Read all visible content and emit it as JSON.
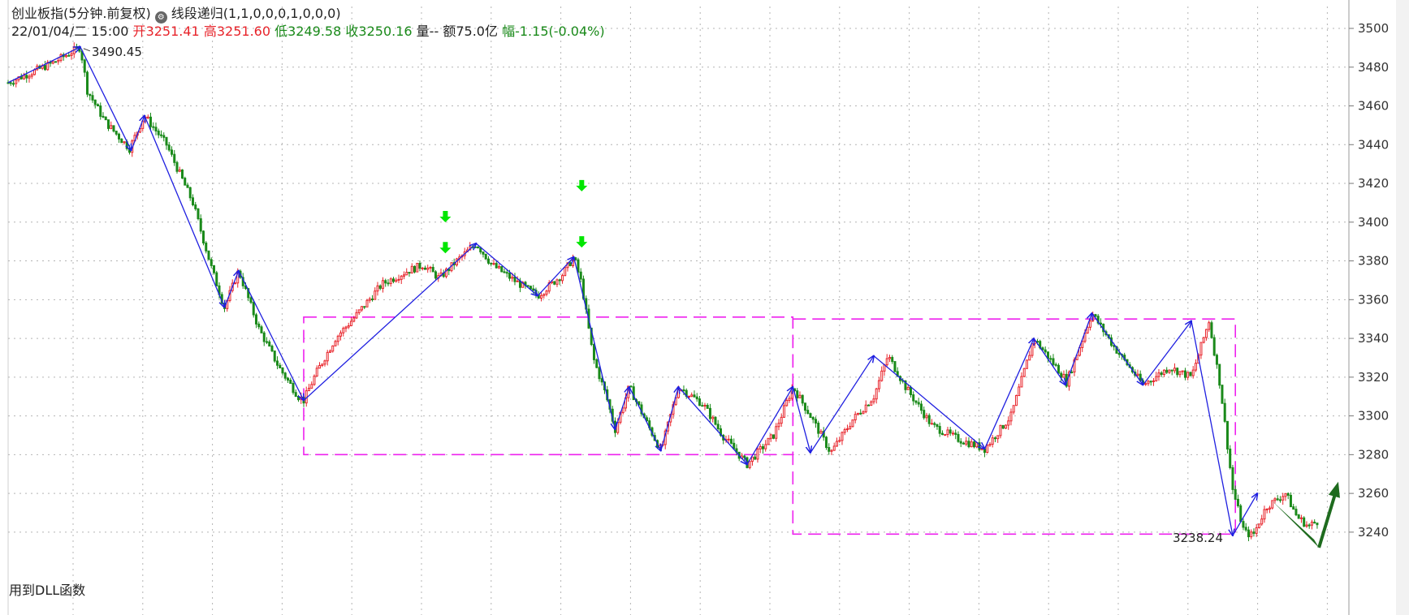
{
  "header": {
    "title": "创业板指(5分钟.前复权)",
    "indicator": "线段递归(1,1,0,0,0,1,0,0,0)",
    "datetime": "22/01/04/二 15:00",
    "open_label": "开",
    "open_value": "3251.41",
    "high_label": "高",
    "high_value": "3251.60",
    "low_label": "低",
    "low_value": "3249.58",
    "close_label": "收",
    "close_value": "3250.16",
    "volume_label": "量--",
    "amount_label": "额",
    "amount_value": "75.0亿",
    "change_label": "幅",
    "change_value": "-1.15(-0.04%)"
  },
  "footer_note": "用到DLL函数",
  "colors": {
    "up": "#e8242b",
    "down": "#1a8a1a",
    "zigzag": "#1f1fe0",
    "box": "#ee22ee",
    "signal": "#00e600",
    "big_arrow": "#1e6b1e",
    "grid": "#b4b4b4"
  },
  "chart_data": {
    "type": "candlestick",
    "ylim": [
      3226,
      3508
    ],
    "xlim": [
      0,
      1000
    ],
    "y_ticks": [
      3240,
      3260,
      3280,
      3300,
      3320,
      3340,
      3360,
      3380,
      3400,
      3420,
      3440,
      3460,
      3480,
      3500
    ],
    "grid": true,
    "price_path": [
      [
        0,
        3472
      ],
      [
        50,
        3482
      ],
      [
        82,
        3490.45
      ],
      [
        90,
        3468
      ],
      [
        110,
        3452
      ],
      [
        138,
        3438
      ],
      [
        155,
        3455
      ],
      [
        180,
        3440
      ],
      [
        210,
        3410
      ],
      [
        232,
        3375
      ],
      [
        246,
        3356
      ],
      [
        262,
        3375
      ],
      [
        285,
        3345
      ],
      [
        308,
        3325
      ],
      [
        330,
        3310
      ],
      [
        336,
        3308
      ],
      [
        350,
        3322
      ],
      [
        372,
        3340
      ],
      [
        392,
        3350
      ],
      [
        425,
        3368
      ],
      [
        455,
        3375
      ],
      [
        472,
        3378
      ],
      [
        490,
        3371
      ],
      [
        510,
        3380
      ],
      [
        532,
        3389
      ],
      [
        550,
        3378
      ],
      [
        575,
        3370
      ],
      [
        602,
        3362
      ],
      [
        630,
        3373
      ],
      [
        643,
        3382
      ],
      [
        652,
        3368
      ],
      [
        665,
        3330
      ],
      [
        680,
        3310
      ],
      [
        690,
        3293
      ],
      [
        706,
        3315
      ],
      [
        722,
        3300
      ],
      [
        742,
        3282
      ],
      [
        762,
        3315
      ],
      [
        790,
        3306
      ],
      [
        812,
        3290
      ],
      [
        840,
        3275
      ],
      [
        870,
        3290
      ],
      [
        892,
        3315
      ],
      [
        912,
        3300
      ],
      [
        935,
        3281
      ],
      [
        960,
        3298
      ],
      [
        984,
        3310
      ],
      [
        1000,
        3331
      ],
      [
        1020,
        3315
      ],
      [
        1050,
        3295
      ],
      [
        1080,
        3288
      ],
      [
        1110,
        3283
      ],
      [
        1140,
        3300
      ],
      [
        1166,
        3340
      ],
      [
        1200,
        3320
      ],
      [
        1202,
        3316
      ],
      [
        1232,
        3353
      ],
      [
        1258,
        3335
      ],
      [
        1290,
        3316
      ],
      [
        1320,
        3325
      ],
      [
        1345,
        3320
      ],
      [
        1365,
        3349
      ],
      [
        1378,
        3315
      ],
      [
        1392,
        3262
      ],
      [
        1405,
        3240
      ],
      [
        1415,
        3238.24
      ],
      [
        1430,
        3253
      ],
      [
        1452,
        3260
      ],
      [
        1465,
        3248
      ],
      [
        1478,
        3243
      ],
      [
        1490,
        3246
      ]
    ],
    "zigzag": [
      [
        0,
        3472
      ],
      [
        82,
        3490.45
      ],
      [
        140,
        3437
      ],
      [
        155,
        3455
      ],
      [
        246,
        3356
      ],
      [
        262,
        3375
      ],
      [
        336,
        3308
      ],
      [
        532,
        3389
      ],
      [
        602,
        3362
      ],
      [
        643,
        3382
      ],
      [
        690,
        3293
      ],
      [
        706,
        3315
      ],
      [
        742,
        3282
      ],
      [
        762,
        3315
      ],
      [
        840,
        3275
      ],
      [
        892,
        3315
      ],
      [
        912,
        3281
      ],
      [
        984,
        3331
      ],
      [
        1110,
        3283
      ],
      [
        1166,
        3340
      ],
      [
        1202,
        3316
      ],
      [
        1232,
        3353
      ],
      [
        1290,
        3316
      ],
      [
        1345,
        3349
      ],
      [
        1392,
        3238.24
      ],
      [
        1420,
        3260
      ]
    ],
    "boxes": [
      {
        "x0": 336,
        "x1": 892,
        "y_low": 3280,
        "y_high": 3351
      },
      {
        "x0": 892,
        "x1": 1395,
        "y_low": 3239,
        "y_high": 3350
      }
    ],
    "sell_signals": [
      {
        "x": 497,
        "y": 3386
      },
      {
        "x": 497,
        "y": 3402
      },
      {
        "x": 652,
        "y": 3389
      },
      {
        "x": 652,
        "y": 3418
      }
    ],
    "annotations": [
      {
        "text": "3490.45",
        "x": 82,
        "y": 3490.45
      },
      {
        "text": "3238.24",
        "x": 1392,
        "y": 3238.24
      }
    ],
    "forecast_arrow": [
      [
        1437,
        3256
      ],
      [
        1490,
        3232
      ],
      [
        1512,
        3266
      ]
    ]
  }
}
